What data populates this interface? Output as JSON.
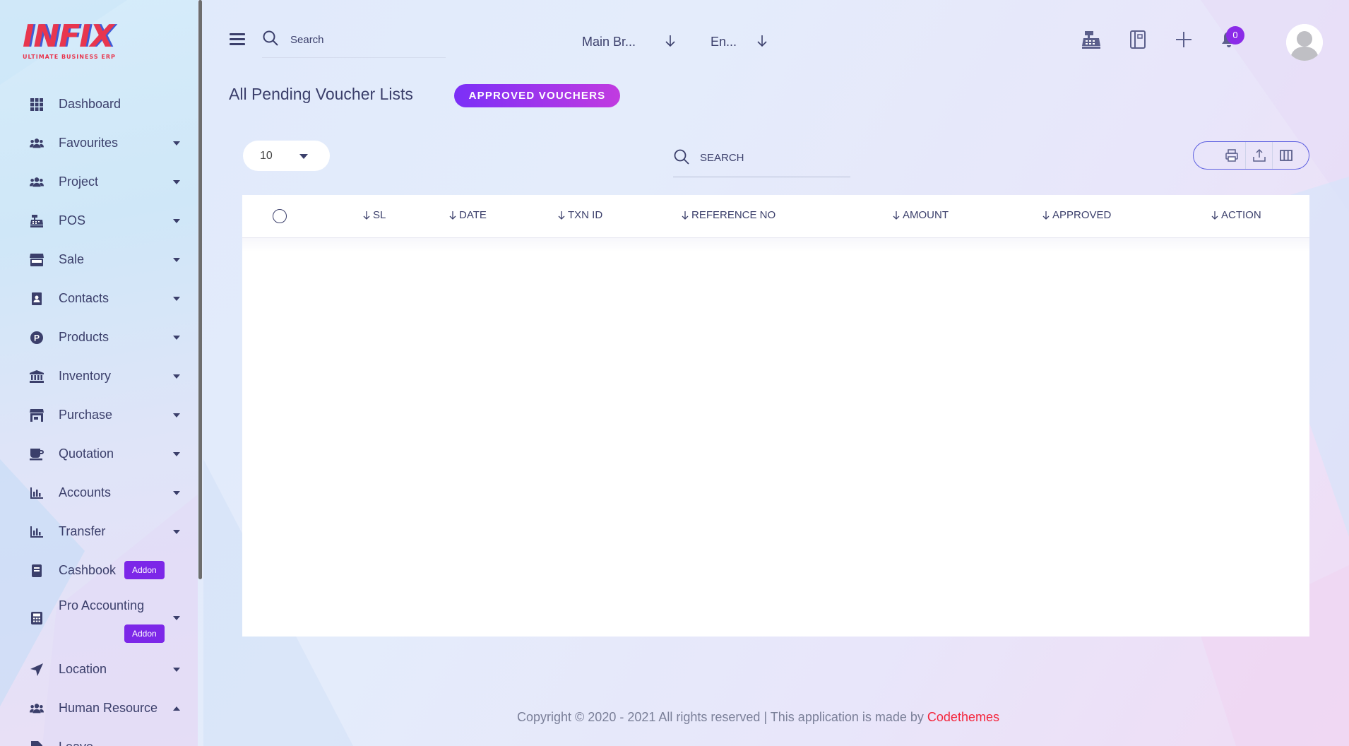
{
  "app": {
    "logo_text": "INFIX",
    "logo_subtitle": "ULTIMATE BUSINESS ERP"
  },
  "sidebar": {
    "items": [
      {
        "label": "Dashboard",
        "icon": "grid-icon"
      },
      {
        "label": "Favourites",
        "icon": "users-icon"
      },
      {
        "label": "Project",
        "icon": "users-icon"
      },
      {
        "label": "POS",
        "icon": "cash-register-icon"
      },
      {
        "label": "Sale",
        "icon": "store-icon"
      },
      {
        "label": "Contacts",
        "icon": "contact-book-icon"
      },
      {
        "label": "Products",
        "icon": "product-p-icon"
      },
      {
        "label": "Inventory",
        "icon": "bank-icon"
      },
      {
        "label": "Purchase",
        "icon": "shop-icon"
      },
      {
        "label": "Quotation",
        "icon": "cup-icon"
      },
      {
        "label": "Accounts",
        "icon": "bar-chart-icon"
      },
      {
        "label": "Transfer",
        "icon": "bar-chart-icon"
      },
      {
        "label": "Cashbook",
        "icon": "book-icon",
        "badge": "Addon"
      },
      {
        "label": "Pro Accounting",
        "icon": "calculator-icon",
        "badge": "Addon"
      },
      {
        "label": "Location",
        "icon": "location-arrow-icon"
      },
      {
        "label": "Human Resource",
        "icon": "users-icon"
      },
      {
        "label": "Leave",
        "icon": "file-icon"
      }
    ]
  },
  "header": {
    "search_placeholder": "Search",
    "branch_select": "Main Br...",
    "language_select": "En...",
    "notification_count": "0"
  },
  "page": {
    "title": "All Pending Voucher Lists",
    "approved_button": "APPROVED VOUCHERS"
  },
  "toolbar": {
    "page_size": "10",
    "search_placeholder": "SEARCH"
  },
  "table": {
    "columns": [
      "SL",
      "DATE",
      "TXN ID",
      "REFERENCE NO",
      "AMOUNT",
      "APPROVED",
      "ACTION"
    ],
    "rows": []
  },
  "footer": {
    "copyright": "Copyright © 2020 - 2021 All rights reserved | This application is made by ",
    "link": "Codethemes"
  },
  "colors": {
    "accent": "#7c27e8",
    "text": "#3b3f6b",
    "link": "#f4253c"
  }
}
